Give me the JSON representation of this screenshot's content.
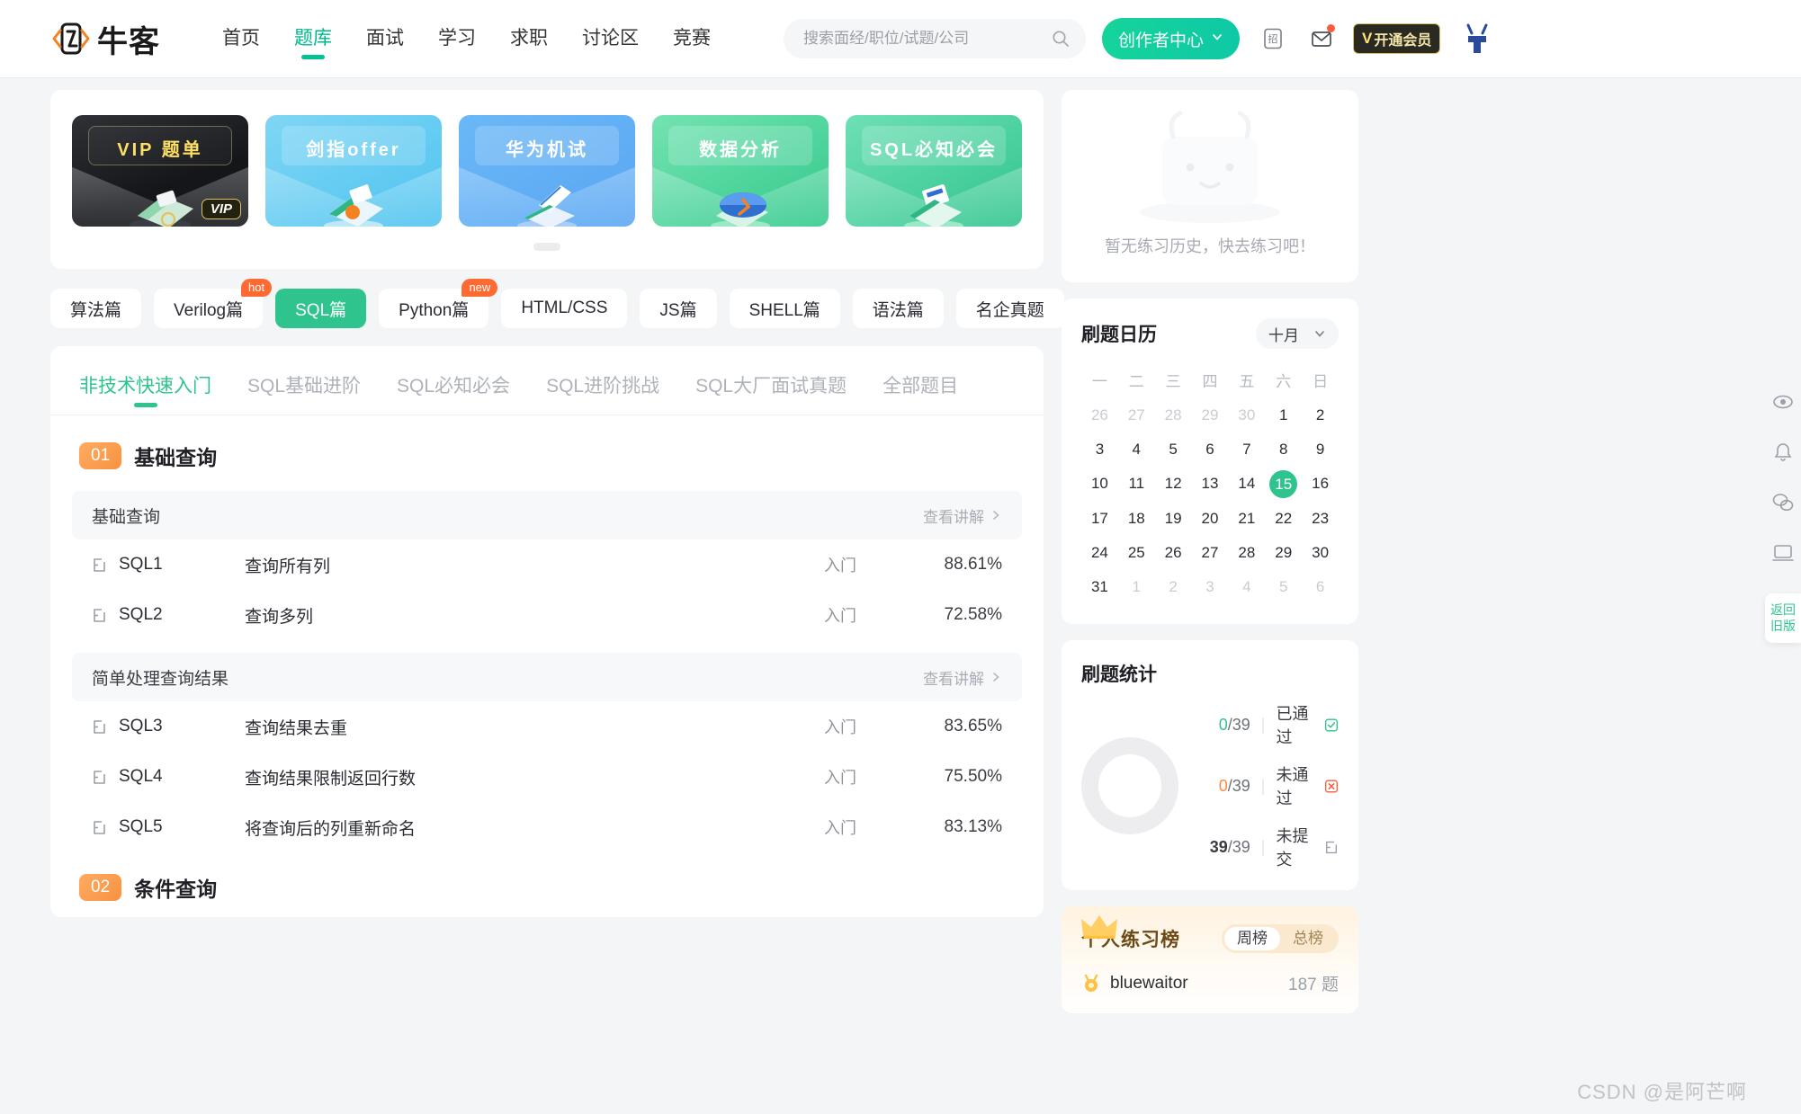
{
  "header": {
    "logo_text": "牛客",
    "nav": [
      {
        "label": "首页",
        "active": false
      },
      {
        "label": "题库",
        "active": true
      },
      {
        "label": "面试",
        "active": false
      },
      {
        "label": "学习",
        "active": false
      },
      {
        "label": "求职",
        "active": false
      },
      {
        "label": "讨论区",
        "active": false
      },
      {
        "label": "竞赛",
        "active": false
      }
    ],
    "search_placeholder": "搜索面经/职位/试题/公司",
    "search_value": "",
    "creator_button": "创作者中心",
    "vip_button_v": "V",
    "vip_button": "开通会员",
    "zhao_icon_label": "招"
  },
  "banners": {
    "cards": [
      {
        "label": "VIP 题单",
        "badge": "VIP",
        "theme": "vip"
      },
      {
        "label": "剑指offer",
        "theme": "c2"
      },
      {
        "label": "华为机试",
        "theme": "c3"
      },
      {
        "label": "数据分析",
        "theme": "c4"
      },
      {
        "label": "SQL必知必会",
        "theme": "c5"
      }
    ]
  },
  "pills": [
    {
      "label": "算法篇",
      "tag": "",
      "active": false
    },
    {
      "label": "Verilog篇",
      "tag": "hot",
      "active": false
    },
    {
      "label": "SQL篇",
      "tag": "",
      "active": true
    },
    {
      "label": "Python篇",
      "tag": "new",
      "active": false
    },
    {
      "label": "HTML/CSS",
      "tag": "",
      "active": false
    },
    {
      "label": "JS篇",
      "tag": "",
      "active": false
    },
    {
      "label": "SHELL篇",
      "tag": "",
      "active": false
    },
    {
      "label": "语法篇",
      "tag": "",
      "active": false
    },
    {
      "label": "名企真题",
      "tag": "",
      "active": false
    }
  ],
  "subtabs": [
    {
      "label": "非技术快速入门",
      "active": true
    },
    {
      "label": "SQL基础进阶",
      "active": false
    },
    {
      "label": "SQL必知必会",
      "active": false
    },
    {
      "label": "SQL进阶挑战",
      "active": false
    },
    {
      "label": "SQL大厂面试真题",
      "active": false
    },
    {
      "label": "全部题目",
      "active": false
    }
  ],
  "sections": [
    {
      "number": "01",
      "title": "基础查询",
      "groups": [
        {
          "title": "基础查询",
          "link": "查看讲解",
          "questions": [
            {
              "id": "SQL1",
              "name": "查询所有列",
              "difficulty": "入门",
              "rate": "88.61%"
            },
            {
              "id": "SQL2",
              "name": "查询多列",
              "difficulty": "入门",
              "rate": "72.58%"
            }
          ]
        },
        {
          "title": "简单处理查询结果",
          "link": "查看讲解",
          "questions": [
            {
              "id": "SQL3",
              "name": "查询结果去重",
              "difficulty": "入门",
              "rate": "83.65%"
            },
            {
              "id": "SQL4",
              "name": "查询结果限制返回行数",
              "difficulty": "入门",
              "rate": "75.50%"
            },
            {
              "id": "SQL5",
              "name": "将查询后的列重新命名",
              "difficulty": "入门",
              "rate": "83.13%"
            }
          ]
        }
      ]
    },
    {
      "number": "02",
      "title": "条件查询",
      "groups": []
    }
  ],
  "sidebar": {
    "empty_text": "暂无练习历史，快去练习吧！",
    "calendar": {
      "title": "刷题日历",
      "month": "十月",
      "weekdays": [
        "一",
        "二",
        "三",
        "四",
        "五",
        "六",
        "日"
      ],
      "weeks": [
        [
          {
            "d": "26",
            "mut": true
          },
          {
            "d": "27",
            "mut": true
          },
          {
            "d": "28",
            "mut": true
          },
          {
            "d": "29",
            "mut": true
          },
          {
            "d": "30",
            "mut": true
          },
          {
            "d": "1",
            "mut": false
          },
          {
            "d": "2",
            "mut": false
          }
        ],
        [
          {
            "d": "3",
            "mut": false
          },
          {
            "d": "4",
            "mut": false
          },
          {
            "d": "5",
            "mut": false
          },
          {
            "d": "6",
            "mut": false
          },
          {
            "d": "7",
            "mut": false
          },
          {
            "d": "8",
            "mut": false
          },
          {
            "d": "9",
            "mut": false
          }
        ],
        [
          {
            "d": "10",
            "mut": false
          },
          {
            "d": "11",
            "mut": false
          },
          {
            "d": "12",
            "mut": false
          },
          {
            "d": "13",
            "mut": false
          },
          {
            "d": "14",
            "mut": false
          },
          {
            "d": "15",
            "mut": false,
            "today": true
          },
          {
            "d": "16",
            "mut": false
          }
        ],
        [
          {
            "d": "17",
            "mut": false
          },
          {
            "d": "18",
            "mut": false
          },
          {
            "d": "19",
            "mut": false
          },
          {
            "d": "20",
            "mut": false
          },
          {
            "d": "21",
            "mut": false
          },
          {
            "d": "22",
            "mut": false
          },
          {
            "d": "23",
            "mut": false
          }
        ],
        [
          {
            "d": "24",
            "mut": false
          },
          {
            "d": "25",
            "mut": false
          },
          {
            "d": "26",
            "mut": false
          },
          {
            "d": "27",
            "mut": false
          },
          {
            "d": "28",
            "mut": false
          },
          {
            "d": "29",
            "mut": false
          },
          {
            "d": "30",
            "mut": false
          }
        ],
        [
          {
            "d": "31",
            "mut": false
          },
          {
            "d": "1",
            "mut": true
          },
          {
            "d": "2",
            "mut": true
          },
          {
            "d": "3",
            "mut": true
          },
          {
            "d": "4",
            "mut": true
          },
          {
            "d": "5",
            "mut": true
          },
          {
            "d": "6",
            "mut": true
          }
        ]
      ]
    },
    "stats": {
      "title": "刷题统计",
      "rows": [
        {
          "num": "0",
          "total": "/39",
          "label": "已通过",
          "kind": "pass"
        },
        {
          "num": "0",
          "total": "/39",
          "label": "未通过",
          "kind": "fail"
        },
        {
          "num": "39",
          "total": "/39",
          "label": "未提交",
          "kind": "none"
        }
      ]
    },
    "ranking": {
      "title": "个人练习榜",
      "tabs": [
        {
          "label": "周榜",
          "active": true
        },
        {
          "label": "总榜",
          "active": false
        }
      ],
      "rows": [
        {
          "name": "bluewaitor",
          "count": "187 题"
        }
      ]
    }
  },
  "watermark": "CSDN @是阿芒啊",
  "colors": {
    "brand_green": "#2fc48d",
    "orange": "#ff6a33",
    "bg": "#f4f5f7"
  }
}
